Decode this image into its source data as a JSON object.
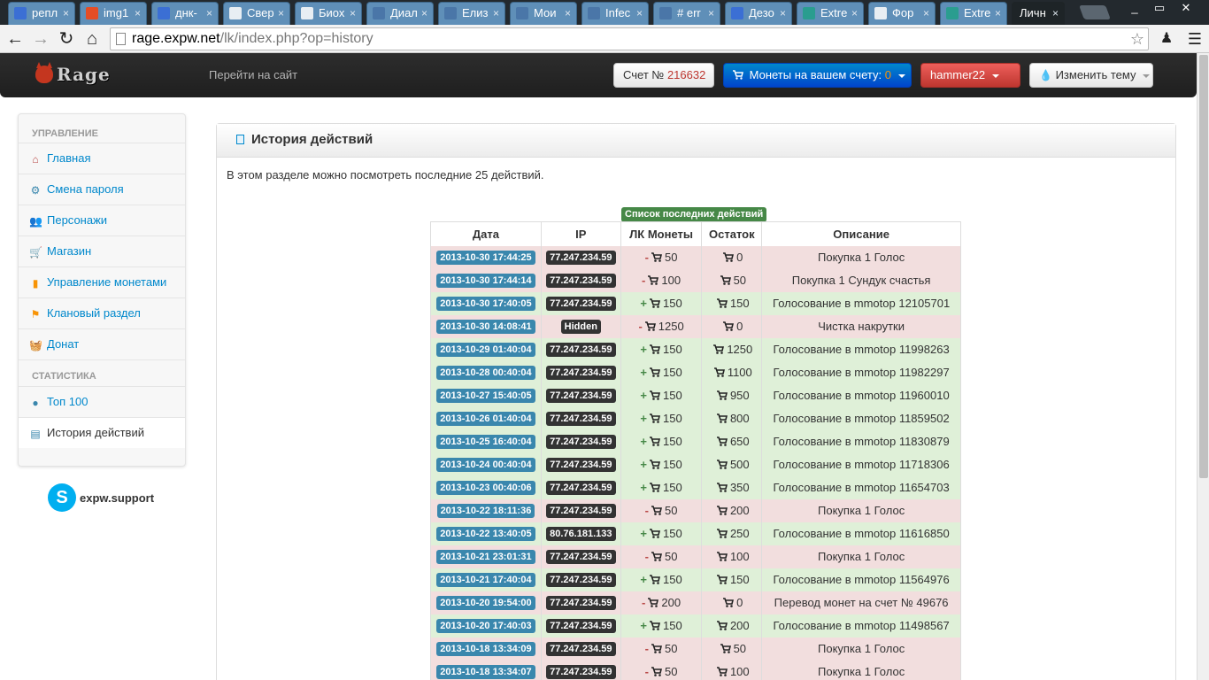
{
  "browser": {
    "tabs": [
      {
        "label": "репл",
        "icon": "google-icon",
        "color": "#3b6fd4"
      },
      {
        "label": "img1",
        "icon": "html5-icon",
        "color": "#e44d26"
      },
      {
        "label": "днк-",
        "icon": "google-icon",
        "color": "#3b6fd4"
      },
      {
        "label": "Свер",
        "icon": "wikipedia-icon",
        "color": "#ffffff"
      },
      {
        "label": "Биох",
        "icon": "page-icon",
        "color": "#ffffff"
      },
      {
        "label": "Диал",
        "icon": "chat-icon",
        "color": "#4a76a8"
      },
      {
        "label": "Елиз",
        "icon": "vk-icon",
        "color": "#4a76a8"
      },
      {
        "label": "Мои",
        "icon": "vk-icon",
        "color": "#4a76a8"
      },
      {
        "label": "Infec",
        "icon": "vk-icon",
        "color": "#4a76a8"
      },
      {
        "label": "# err",
        "icon": "vk-icon",
        "color": "#4a76a8"
      },
      {
        "label": "Дезо",
        "icon": "shield-icon",
        "color": "#3b6fd4"
      },
      {
        "label": "Extre",
        "icon": "extreme-icon",
        "color": "#2a9d8f"
      },
      {
        "label": "Фор",
        "icon": "page-icon",
        "color": "#ffffff"
      },
      {
        "label": "Extre",
        "icon": "extreme-icon",
        "color": "#2a9d8f"
      },
      {
        "label": "Личн",
        "icon": "none",
        "color": "#000000",
        "active": true
      }
    ],
    "url_host": "rage.expw.net",
    "url_path": "/lk/index.php?op=history"
  },
  "navbar": {
    "logo_text": "Rage",
    "goto_site": "Перейти на сайт",
    "account_label": "Счет №",
    "account_number": "216632",
    "coins_label": "Монеты на вашем счету:",
    "coins_value": "0",
    "user": "hammer22",
    "theme": "Изменить тему"
  },
  "sidebar": {
    "heading_manage": "УПРАВЛЕНИЕ",
    "items": [
      {
        "label": "Главная",
        "icon": "home-icon",
        "color": "#b94a48"
      },
      {
        "label": "Смена пароля",
        "icon": "gear-icon",
        "color": "#3a87ad"
      },
      {
        "label": "Персонажи",
        "icon": "users-icon",
        "color": "#f89406"
      },
      {
        "label": "Магазин",
        "icon": "cart-icon",
        "color": "#468847"
      },
      {
        "label": "Управление монетами",
        "icon": "coins-icon",
        "color": "#f89406"
      },
      {
        "label": "Клановый раздел",
        "icon": "flag-icon",
        "color": "#f89406"
      },
      {
        "label": "Донат",
        "icon": "basket-icon",
        "color": "#b94a48"
      }
    ],
    "heading_stats": "СТАТИСТИКА",
    "stats_items": [
      {
        "label": "Топ 100",
        "icon": "globe-icon",
        "color": "#3a87ad"
      },
      {
        "label": "История действий",
        "icon": "document-icon",
        "color": "#3a87ad",
        "active": true
      }
    ],
    "skype": "expw.support"
  },
  "panel": {
    "title": "История действий",
    "intro": "В этом разделе можно посмотреть последние 25 действий.",
    "table_caption": "Список последних действий",
    "columns": [
      "Дата",
      "IP",
      "ЛК Монеты",
      "Остаток",
      "Описание"
    ],
    "rows": [
      {
        "date": "2013-10-30 17:44:25",
        "ip": "77.247.234.59",
        "sign": "-",
        "amount": "50",
        "balance": "0",
        "desc": "Покупка 1 Голос"
      },
      {
        "date": "2013-10-30 17:44:14",
        "ip": "77.247.234.59",
        "sign": "-",
        "amount": "100",
        "balance": "50",
        "desc": "Покупка 1 Сундук счастья"
      },
      {
        "date": "2013-10-30 17:40:05",
        "ip": "77.247.234.59",
        "sign": "+",
        "amount": "150",
        "balance": "150",
        "desc": "Голосование в mmotop 12105701"
      },
      {
        "date": "2013-10-30 14:08:41",
        "ip": "Hidden",
        "sign": "-",
        "amount": "1250",
        "balance": "0",
        "desc": "Чистка накрутки"
      },
      {
        "date": "2013-10-29 01:40:04",
        "ip": "77.247.234.59",
        "sign": "+",
        "amount": "150",
        "balance": "1250",
        "desc": "Голосование в mmotop 11998263"
      },
      {
        "date": "2013-10-28 00:40:04",
        "ip": "77.247.234.59",
        "sign": "+",
        "amount": "150",
        "balance": "1100",
        "desc": "Голосование в mmotop 11982297"
      },
      {
        "date": "2013-10-27 15:40:05",
        "ip": "77.247.234.59",
        "sign": "+",
        "amount": "150",
        "balance": "950",
        "desc": "Голосование в mmotop 11960010"
      },
      {
        "date": "2013-10-26 01:40:04",
        "ip": "77.247.234.59",
        "sign": "+",
        "amount": "150",
        "balance": "800",
        "desc": "Голосование в mmotop 11859502"
      },
      {
        "date": "2013-10-25 16:40:04",
        "ip": "77.247.234.59",
        "sign": "+",
        "amount": "150",
        "balance": "650",
        "desc": "Голосование в mmotop 11830879"
      },
      {
        "date": "2013-10-24 00:40:04",
        "ip": "77.247.234.59",
        "sign": "+",
        "amount": "150",
        "balance": "500",
        "desc": "Голосование в mmotop 11718306"
      },
      {
        "date": "2013-10-23 00:40:06",
        "ip": "77.247.234.59",
        "sign": "+",
        "amount": "150",
        "balance": "350",
        "desc": "Голосование в mmotop 11654703"
      },
      {
        "date": "2013-10-22 18:11:36",
        "ip": "77.247.234.59",
        "sign": "-",
        "amount": "50",
        "balance": "200",
        "desc": "Покупка 1 Голос"
      },
      {
        "date": "2013-10-22 13:40:05",
        "ip": "80.76.181.133",
        "sign": "+",
        "amount": "150",
        "balance": "250",
        "desc": "Голосование в mmotop 11616850"
      },
      {
        "date": "2013-10-21 23:01:31",
        "ip": "77.247.234.59",
        "sign": "-",
        "amount": "50",
        "balance": "100",
        "desc": "Покупка 1 Голос"
      },
      {
        "date": "2013-10-21 17:40:04",
        "ip": "77.247.234.59",
        "sign": "+",
        "amount": "150",
        "balance": "150",
        "desc": "Голосование в mmotop 11564976"
      },
      {
        "date": "2013-10-20 19:54:00",
        "ip": "77.247.234.59",
        "sign": "-",
        "amount": "200",
        "balance": "0",
        "desc": "Перевод монет на счет № 49676"
      },
      {
        "date": "2013-10-20 17:40:03",
        "ip": "77.247.234.59",
        "sign": "+",
        "amount": "150",
        "balance": "200",
        "desc": "Голосование в mmotop 11498567"
      },
      {
        "date": "2013-10-18 13:34:09",
        "ip": "77.247.234.59",
        "sign": "-",
        "amount": "50",
        "balance": "50",
        "desc": "Покупка 1 Голос"
      },
      {
        "date": "2013-10-18 13:34:07",
        "ip": "77.247.234.59",
        "sign": "-",
        "amount": "50",
        "balance": "100",
        "desc": "Покупка 1 Голос"
      }
    ]
  },
  "colors": {
    "minus_row": "#f2dede",
    "plus_row": "#dff0d8",
    "date_label": "#3a87ad",
    "ip_label": "#333333",
    "brand_red": "#bd362f",
    "brand_blue": "#0088cc"
  }
}
